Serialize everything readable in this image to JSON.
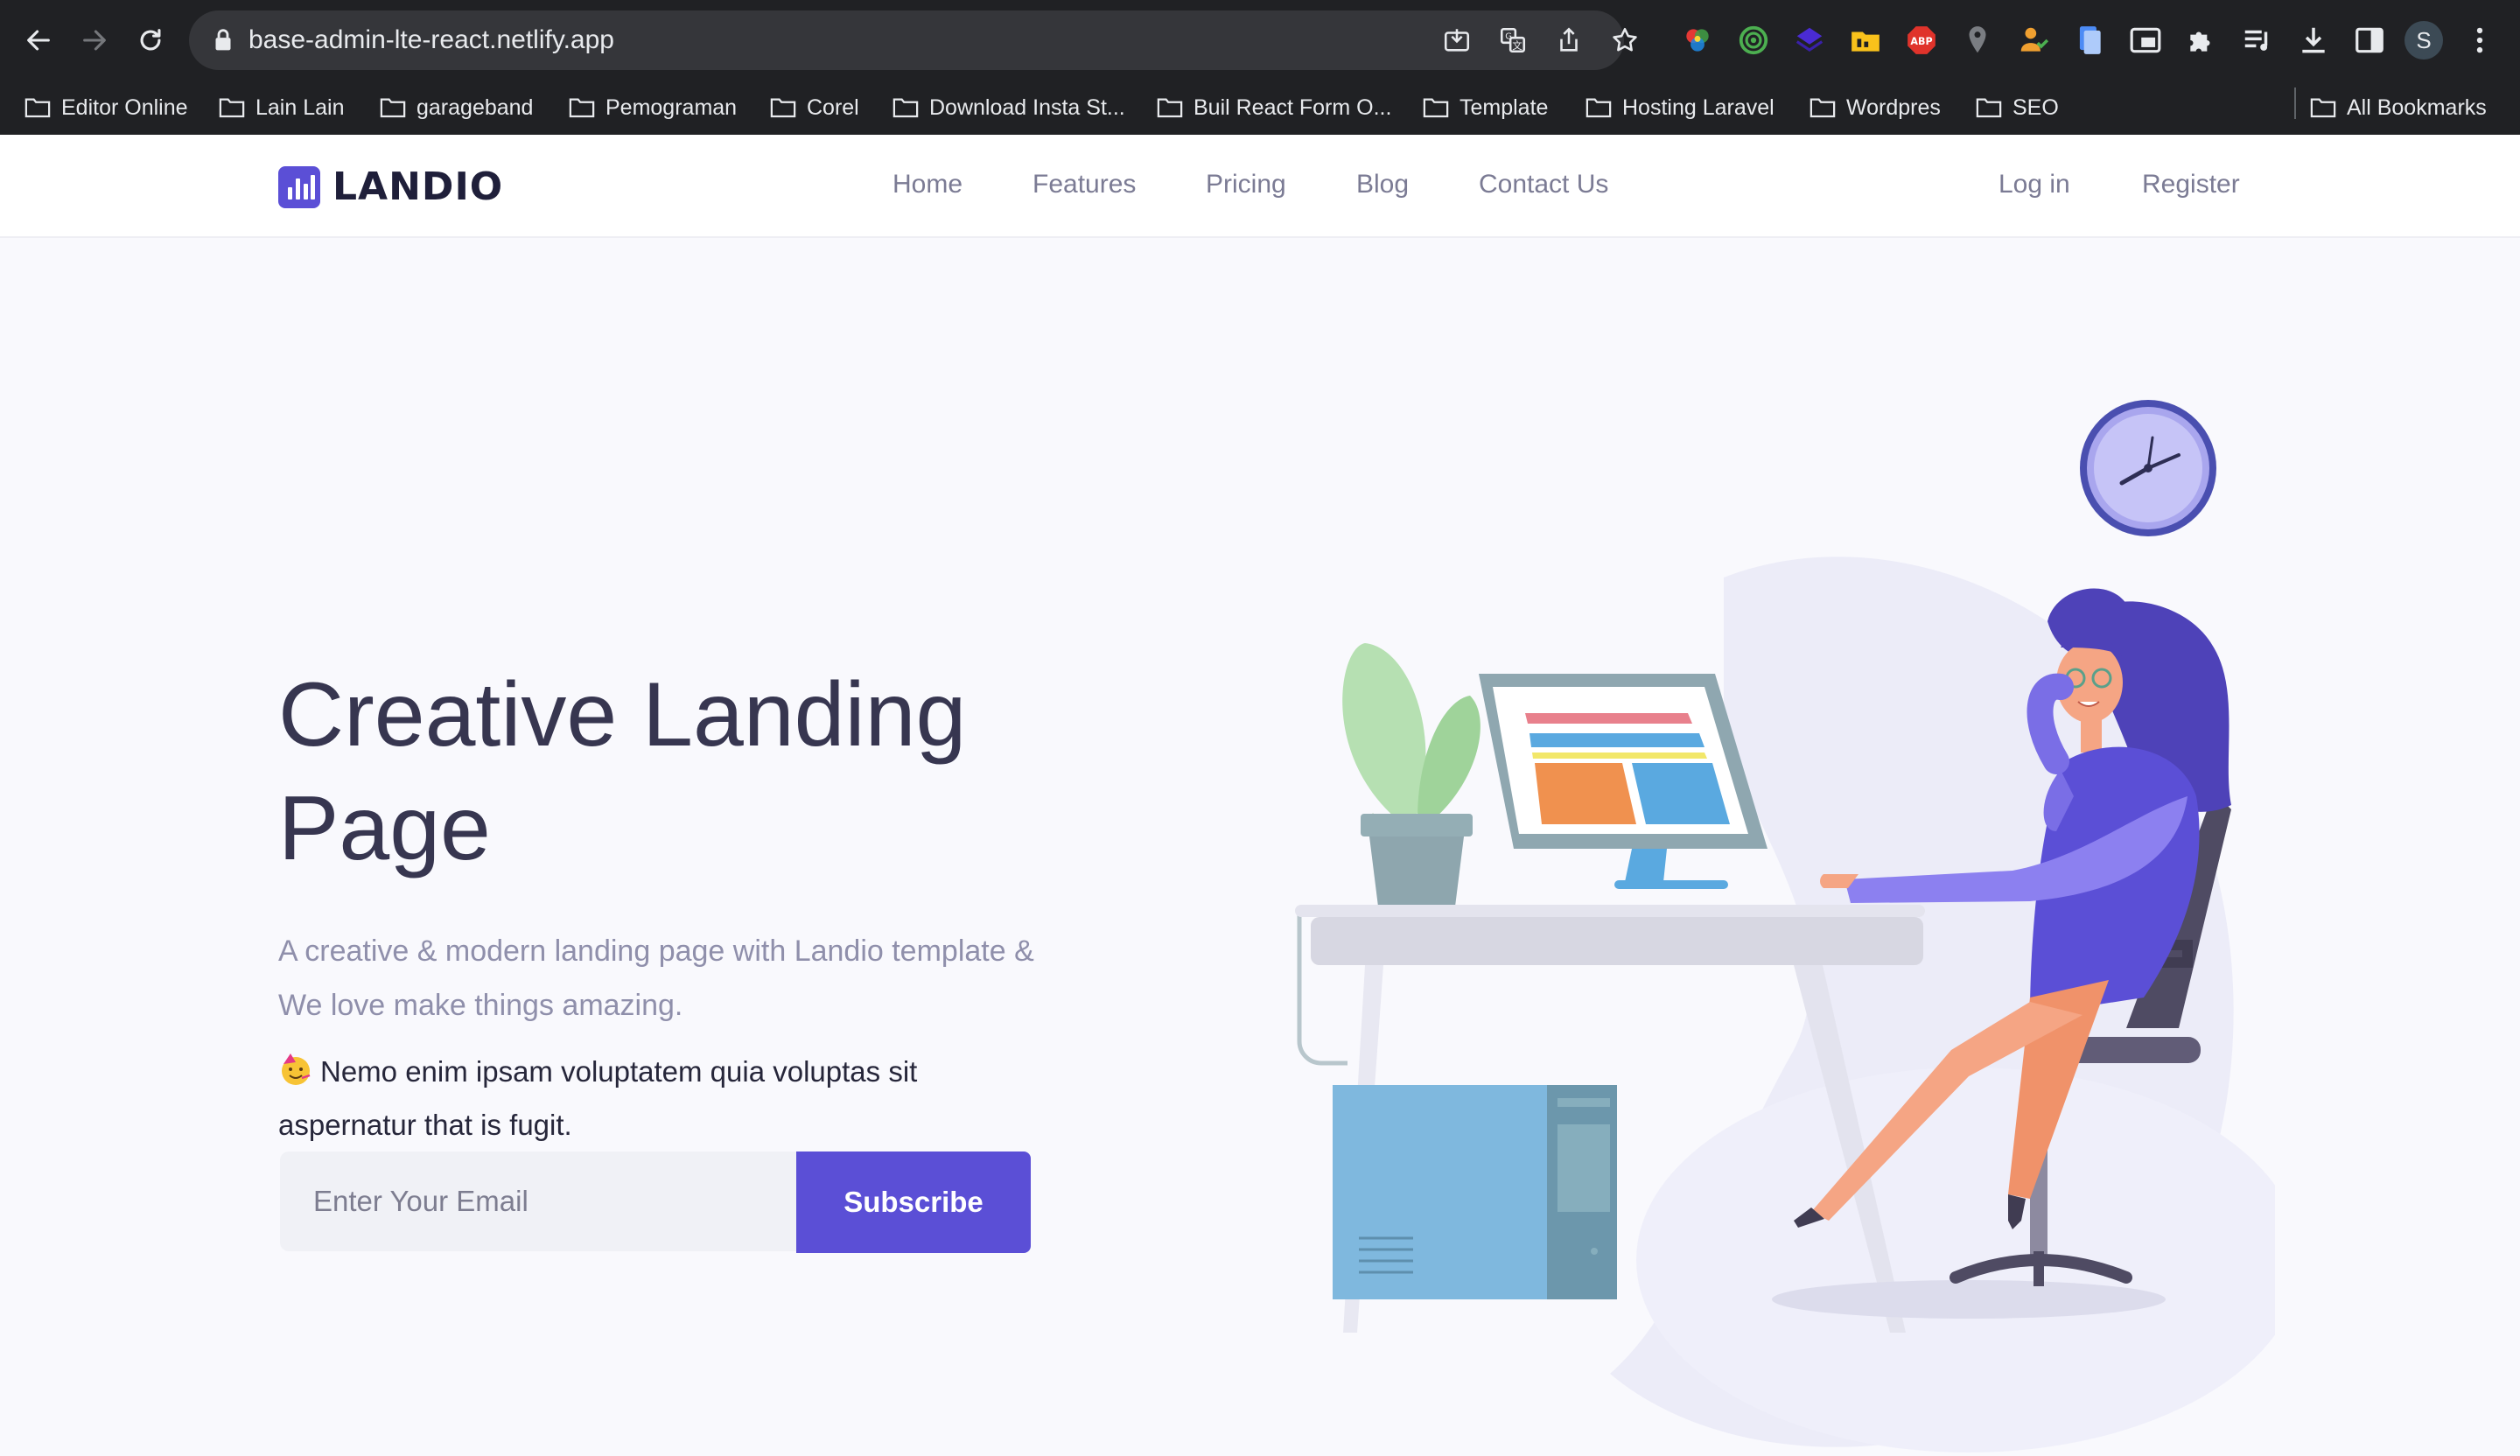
{
  "browser": {
    "url": "base-admin-lte-react.netlify.app",
    "profile_initial": "S",
    "bookmarks": [
      "Editor Online",
      "Lain Lain",
      "garageband",
      "Pemograman",
      "Corel",
      "Download Insta St...",
      "Buil React Form O...",
      "Template",
      "Hosting Laravel",
      "Wordpres",
      "SEO"
    ],
    "all_bookmarks": "All Bookmarks"
  },
  "site": {
    "logo": "LANDIO",
    "nav": [
      "Home",
      "Features",
      "Pricing",
      "Blog",
      "Contact Us"
    ],
    "auth": {
      "login": "Log in",
      "register": "Register"
    }
  },
  "hero": {
    "title": "Creative Landing Page",
    "subtitle": "A creative & modern landing page with Landio template & We love make things amazing.",
    "note": "Nemo enim ipsam voluptatem quia voluptas sit aspernatur that is fugit.",
    "email_placeholder": "Enter Your Email",
    "subscribe_label": "Subscribe"
  },
  "colors": {
    "brand": "#5b4fd6",
    "heading": "#373650",
    "muted": "#8f8fab",
    "chrome": "#202124"
  }
}
